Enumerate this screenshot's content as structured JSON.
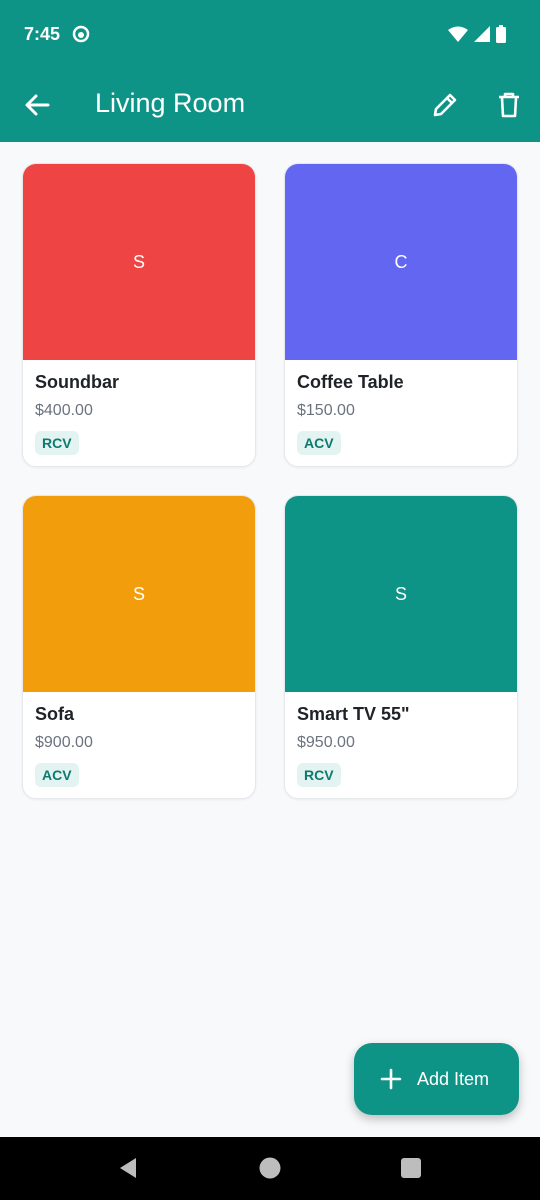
{
  "status_bar": {
    "time": "7:45",
    "icons": [
      "app-notification-icon",
      "wifi-icon",
      "signal-icon",
      "battery-icon"
    ]
  },
  "app_bar": {
    "title": "Living Room",
    "icons": [
      "back-arrow-icon",
      "edit-pencil-icon",
      "trash-icon"
    ]
  },
  "items": [
    {
      "initial": "S",
      "name": "Soundbar",
      "price": "$400.00",
      "badge": "RCV",
      "color": "#ef4444"
    },
    {
      "initial": "C",
      "name": "Coffee Table",
      "price": "$150.00",
      "badge": "ACV",
      "color": "#6366f1"
    },
    {
      "initial": "S",
      "name": "Sofa",
      "price": "$900.00",
      "badge": "ACV",
      "color": "#f29e0c"
    },
    {
      "initial": "S",
      "name": "Smart TV 55\"",
      "price": "$950.00",
      "badge": "RCV",
      "color": "#0e9486"
    }
  ],
  "fab": {
    "label": "Add Item",
    "icon": "plus-icon"
  },
  "nav_bar": {
    "icons": [
      "nav-back-icon",
      "nav-home-icon",
      "nav-recents-icon"
    ]
  },
  "colors": {
    "primary": "#0e9486",
    "background": "#f8f9fb",
    "badge_bg": "#e2f3f1",
    "badge_text": "#0e7a6f"
  }
}
